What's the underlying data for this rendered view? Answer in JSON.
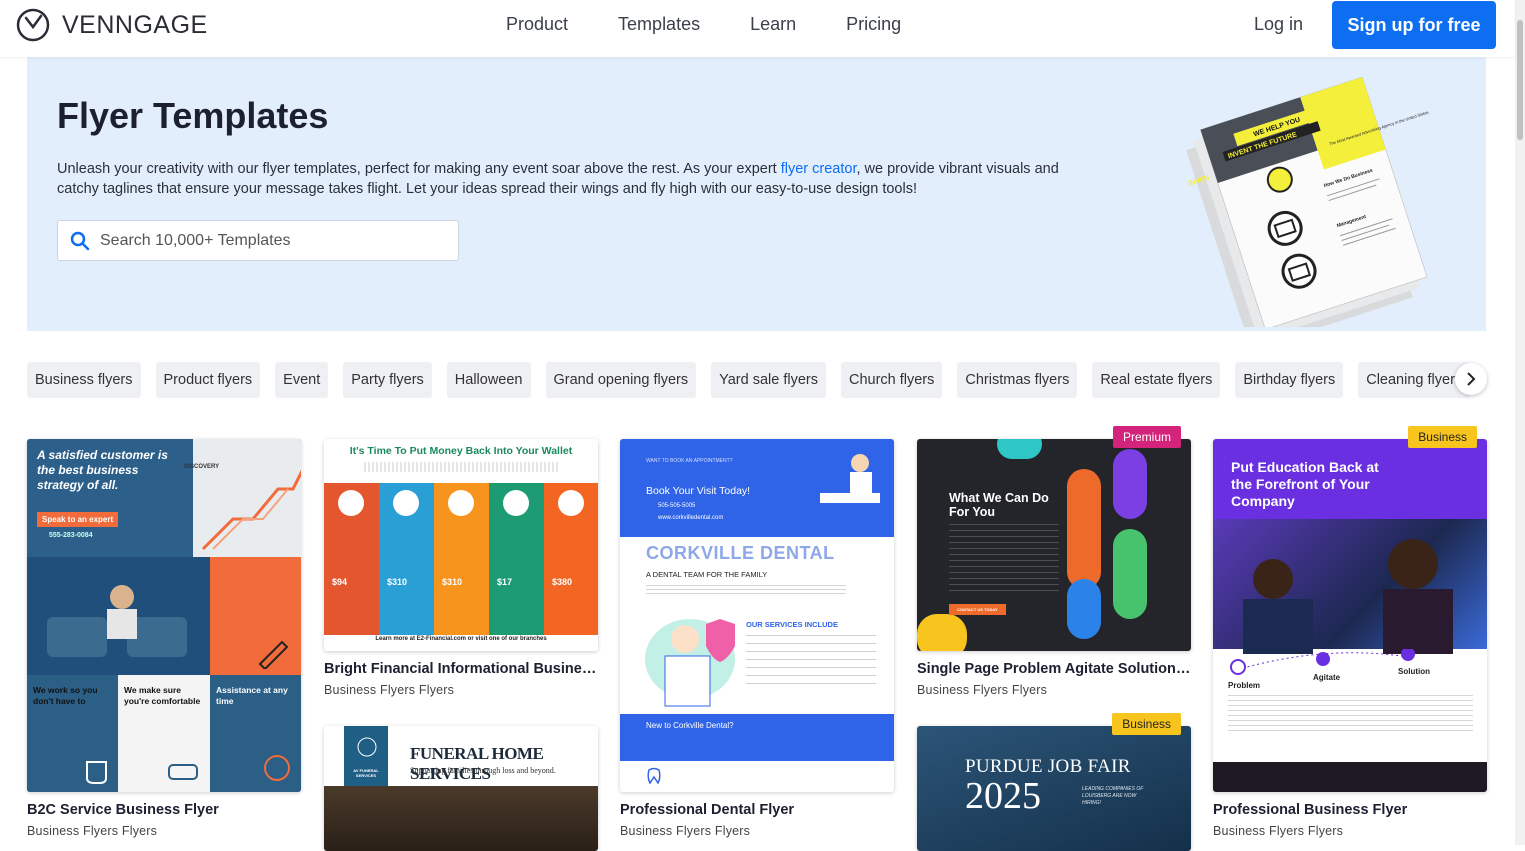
{
  "nav": {
    "brand": "VENNGAGE",
    "links": [
      "Product",
      "Templates",
      "Learn",
      "Pricing"
    ],
    "login": "Log in",
    "signup": "Sign up for free"
  },
  "hero": {
    "title": "Flyer Templates",
    "desc_before": "Unleash your creativity with our flyer templates, perfect for making any event soar above the rest. As your expert ",
    "desc_link": "flyer creator",
    "desc_after": ", we provide vibrant visuals and catchy taglines that ensure your message takes flight. Let your ideas spread their wings and fly high with our easy-to-use design tools!",
    "search_placeholder": "Search 10,000+ Templates",
    "art": {
      "banner1": "WE HELP YOU",
      "banner2": "INVENT THE FUTURE",
      "side": "INVEN",
      "para": "The Most Awarded Advertising Agency in the United States",
      "h1": "How We Do Business",
      "h2": "Management"
    }
  },
  "chips": [
    "Business flyers",
    "Product flyers",
    "Event",
    "Party flyers",
    "Halloween",
    "Grand opening flyers",
    "Yard sale flyers",
    "Church flyers",
    "Christmas flyers",
    "Real estate flyers",
    "Birthday flyers",
    "Cleaning flyers"
  ],
  "cards": {
    "c1": {
      "title": "B2C Service Business Flyer",
      "sub": "Business Flyers Flyers",
      "headline": "A satisfied customer is the best business strategy of all.",
      "cta": "Speak to an expert",
      "phone": "555-283-0084",
      "brand": "DISCOVERY",
      "b1": "We work so you don't have to",
      "b2": "We make sure you're comfortable",
      "b3": "Assistance at any time"
    },
    "c2": {
      "title": "Bright Financial Informational Business Flyer",
      "sub": "Business Flyers Flyers",
      "headline": "It's Time To Put Money Back Into Your Wallet",
      "prices": [
        "$94",
        "$310",
        "$310",
        "$17",
        "$380"
      ],
      "footer": "Learn more at E2-Financial.com or visit one of our branches"
    },
    "c3": {
      "headline": "FUNERAL HOME SERVICES",
      "tagline": "Supporting families through loss and beyond.",
      "brand": "AV FUNERAL SERVICES"
    },
    "c4": {
      "title": "Professional Dental Flyer",
      "sub": "Business Flyers Flyers",
      "top": "WANT TO BOOK AN APPOINTMENT?",
      "cta": "Book Your Visit Today!",
      "phone": "505-505-5005",
      "site": "www.corkvilledental.com",
      "brand": "CORKVILLE DENTAL",
      "tag": "A DENTAL TEAM FOR THE FAMILY",
      "services": "OUR SERVICES INCLUDE",
      "new": "New to Corkville Dental?"
    },
    "c5": {
      "badge": "Premium",
      "title": "Single Page Problem Agitate Solution Flyer",
      "sub": "Business Flyers Flyers",
      "headline": "What We Can Do For You",
      "cta": "CONTACT US TODAY"
    },
    "c6": {
      "badge": "Business",
      "headline": "PURDUE JOB FAIR",
      "year": "2025",
      "side": "LEADING COMPANIES OF LOUISBERG ARE NOW HIRING!"
    },
    "c7": {
      "badge": "Business",
      "title": "Professional Business Flyer",
      "sub": "Business Flyers Flyers",
      "headline": "Put Education Back at the Forefront of Your Company",
      "steps": [
        "Problem",
        "Agitate",
        "Solution"
      ]
    }
  }
}
